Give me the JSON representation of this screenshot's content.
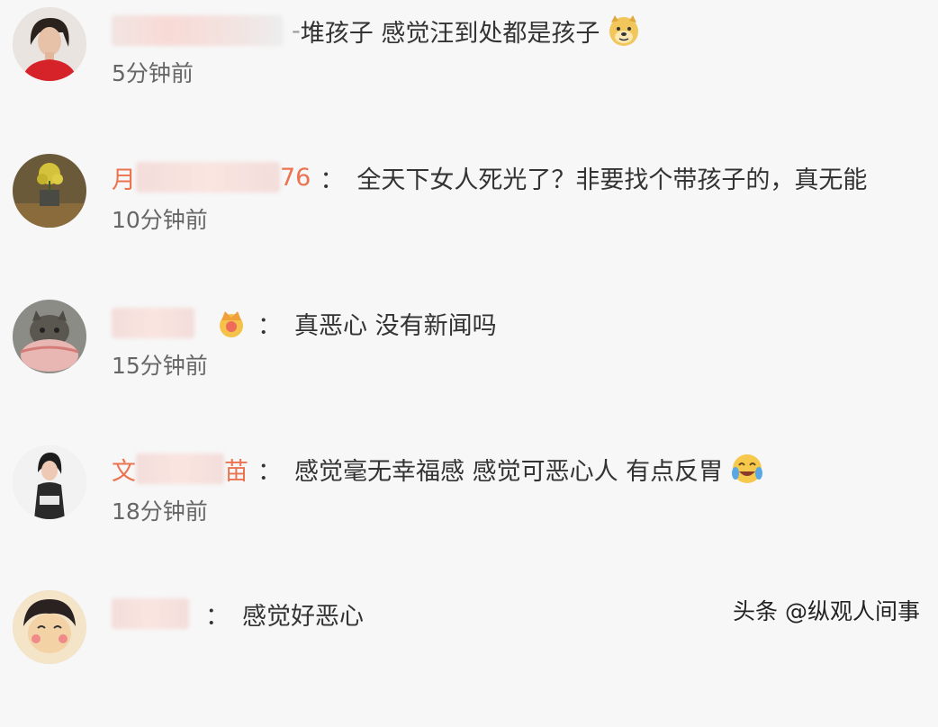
{
  "comments": [
    {
      "user_tail": "-",
      "text": "堆孩子 感觉汪到处都是孩子",
      "emoji": "doge-emoji",
      "time": "5分钟前"
    },
    {
      "user_head": "月",
      "user_tail": "76",
      "colon": "：",
      "text": "全天下女人死光了？非要找个带孩子的，真无能",
      "time": "10分钟前"
    },
    {
      "colon": "：",
      "text": "真恶心 没有新闻吗",
      "badge": "crown-badge",
      "time": "15分钟前"
    },
    {
      "user_head": "文",
      "user_tail": "苗",
      "colon": "：",
      "text": "感觉毫无幸福感 感觉可恶心人 有点反胃",
      "emoji": "laugh-cry-emoji",
      "time": "18分钟前"
    },
    {
      "colon": "：",
      "text": "感觉好恶心"
    }
  ],
  "watermark": "头条 @纵观人间事"
}
